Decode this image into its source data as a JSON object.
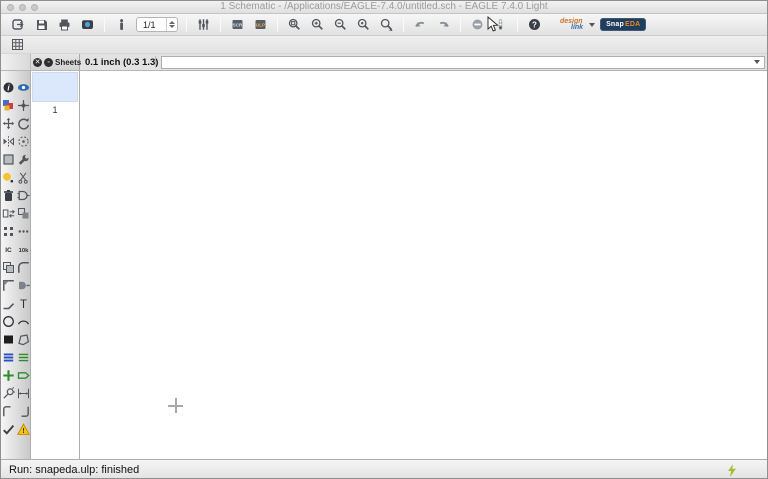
{
  "window": {
    "title": "1 Schematic - /Applications/EAGLE-7.4.0/untitled.sch - EAGLE 7.4.0 Light"
  },
  "toolbar": {
    "sheet_spinner_value": "1/1",
    "items": [
      {
        "type": "button",
        "icon": "open"
      },
      {
        "type": "button",
        "icon": "save"
      },
      {
        "type": "button",
        "icon": "print"
      },
      {
        "type": "button",
        "icon": "export-image"
      },
      {
        "type": "sep"
      },
      {
        "type": "button",
        "icon": "use-library"
      },
      {
        "type": "spinner"
      },
      {
        "type": "sep"
      },
      {
        "type": "button",
        "icon": "grid-settings"
      },
      {
        "type": "sep"
      },
      {
        "type": "button",
        "icon": "script"
      },
      {
        "type": "button",
        "icon": "run-ulp"
      },
      {
        "type": "sep"
      },
      {
        "type": "button",
        "icon": "zoom-fit"
      },
      {
        "type": "button",
        "icon": "zoom-in"
      },
      {
        "type": "button",
        "icon": "zoom-out"
      },
      {
        "type": "button",
        "icon": "zoom-redraw"
      },
      {
        "type": "button",
        "icon": "zoom-select"
      },
      {
        "type": "sep"
      },
      {
        "type": "button",
        "icon": "undo"
      },
      {
        "type": "button",
        "icon": "redo"
      },
      {
        "type": "sep"
      },
      {
        "type": "button",
        "icon": "stop"
      },
      {
        "type": "button",
        "icon": "go"
      },
      {
        "type": "sep"
      },
      {
        "type": "button",
        "icon": "help"
      },
      {
        "type": "designlink"
      },
      {
        "type": "snapeda"
      }
    ],
    "designlink": {
      "top": "design",
      "bottom": "link"
    },
    "snapeda": {
      "part1": "Snap",
      "part2": "EDA"
    }
  },
  "commandbar": {
    "coordinate_display": "0.1 inch (0.3 1.3)",
    "command_value": ""
  },
  "sheets_panel": {
    "header": "Sheets",
    "close_glyph": "✕",
    "float_glyph": "◦",
    "sheets": [
      {
        "number": "1",
        "selected": true
      }
    ]
  },
  "palette_rows": [
    [
      "info",
      "show"
    ],
    [
      "display",
      "mark"
    ],
    [
      "move",
      "rotate"
    ],
    [
      "mirror",
      "spin"
    ],
    [
      "group",
      "change"
    ],
    [
      "paint",
      "cut"
    ],
    [
      "delete",
      "add-part"
    ],
    [
      "pinswap",
      "replace"
    ],
    [
      "smash",
      "split"
    ],
    [
      "name",
      "value"
    ],
    [
      "copy",
      "miter"
    ],
    [
      "corner",
      "invoke"
    ],
    [
      "wire",
      "text"
    ],
    [
      "circle",
      "arc"
    ],
    [
      "rect",
      "polygon"
    ],
    [
      "bus",
      "net"
    ],
    [
      "junction",
      "label"
    ],
    [
      "attribute",
      "dimension"
    ],
    [
      "frame-left",
      "frame-right"
    ],
    [
      "erc",
      "errors"
    ]
  ],
  "statusbar": {
    "message": "Run: snapeda.ulp: finished"
  },
  "colors": {
    "snapeda_bg": "#1f3d5c",
    "snapeda_text": "#ffffff",
    "snapeda_accent": "#e8862a",
    "designlink_orange": "#c9742a",
    "designlink_blue": "#3a6fb0",
    "status_bolt": "#a2c037",
    "sheet_selected_bg": "#dbe7fa"
  }
}
